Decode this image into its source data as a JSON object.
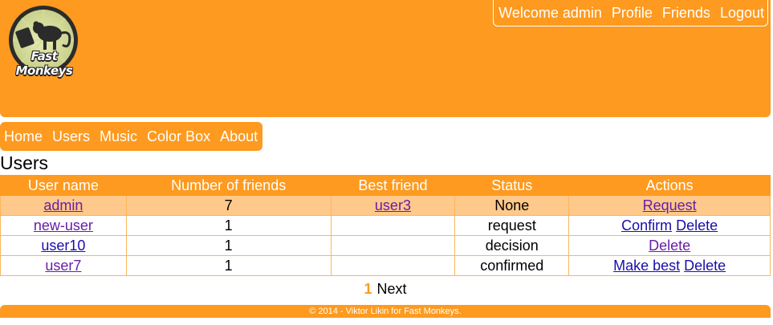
{
  "header": {
    "logo_text": "Fast Monkeys",
    "user_nav": {
      "welcome": "Welcome admin",
      "links": [
        "Profile",
        "Friends",
        "Logout"
      ]
    }
  },
  "main_nav": {
    "items": [
      "Home",
      "Users",
      "Music",
      "Color Box",
      "About"
    ]
  },
  "page": {
    "title": "Users"
  },
  "table": {
    "headers": [
      "User name",
      "Number of friends",
      "Best friend",
      "Status",
      "Actions"
    ],
    "rows": [
      {
        "user": "admin",
        "friends": "7",
        "best_friend": "user3",
        "status": "None",
        "actions": [
          "Request"
        ]
      },
      {
        "user": "new-user",
        "friends": "1",
        "best_friend": "",
        "status": "request",
        "actions": [
          "Confirm",
          "Delete"
        ]
      },
      {
        "user": "user10",
        "friends": "1",
        "best_friend": "",
        "status": "decision",
        "actions": [
          "Delete"
        ]
      },
      {
        "user": "user7",
        "friends": "1",
        "best_friend": "",
        "status": "confirmed",
        "actions": [
          "Make best",
          "Delete"
        ]
      }
    ]
  },
  "pagination": {
    "current": "1",
    "next": "Next"
  },
  "footer": {
    "text": "© 2014 - Viktor Likin for Fast Monkeys."
  },
  "colors": {
    "brand_orange": "#fd9a1f",
    "row_highlight": "#fec98a",
    "link": "#1a0dab",
    "visited_link": "#681da8"
  }
}
